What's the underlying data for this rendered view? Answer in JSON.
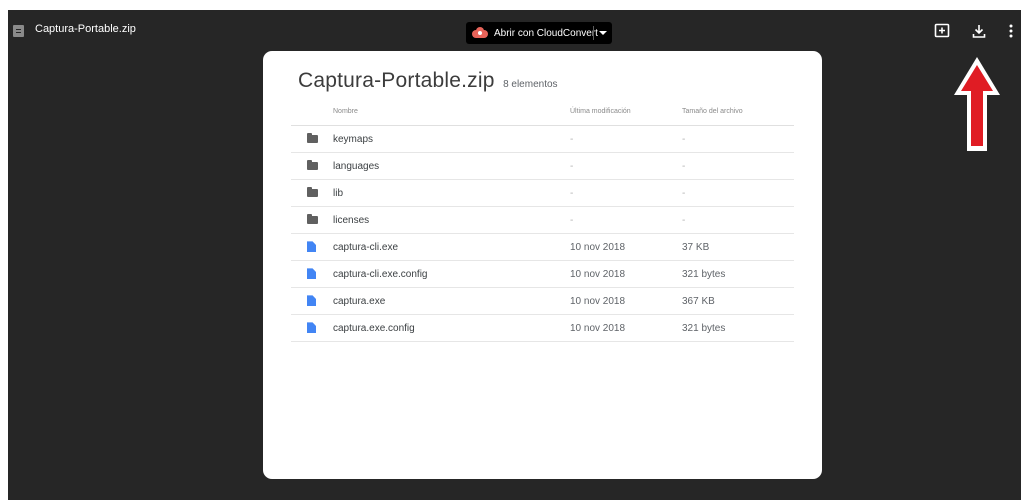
{
  "topbar": {
    "file_name": "Captura-Portable.zip",
    "open_with_label": "Abrir con CloudConvert",
    "icons": [
      "file-icon",
      "cloudconvert-icon",
      "chevron-down-icon",
      "add-comment-icon",
      "download-icon",
      "more-vert-icon"
    ]
  },
  "annotation": {
    "arrow_color": "#e01c24",
    "icon": "red-up-arrow-icon"
  },
  "card": {
    "title": "Captura-Portable.zip",
    "count": "8 elementos",
    "columns": {
      "name": "Nombre",
      "modified": "Última modificación",
      "size": "Tamaño del archivo"
    },
    "rows": [
      {
        "kind": "folder",
        "icon": "folder-icon",
        "name": "keymaps",
        "modified": "-",
        "size": "-"
      },
      {
        "kind": "folder",
        "icon": "folder-icon",
        "name": "languages",
        "modified": "-",
        "size": "-"
      },
      {
        "kind": "folder",
        "icon": "folder-icon",
        "name": "lib",
        "modified": "-",
        "size": "-"
      },
      {
        "kind": "folder",
        "icon": "folder-icon",
        "name": "licenses",
        "modified": "-",
        "size": "-"
      },
      {
        "kind": "file",
        "icon": "file-doc-icon",
        "name": "captura-cli.exe",
        "modified": "10 nov 2018",
        "size": "37 KB"
      },
      {
        "kind": "file",
        "icon": "file-doc-icon",
        "name": "captura-cli.exe.config",
        "modified": "10 nov 2018",
        "size": "321 bytes"
      },
      {
        "kind": "file",
        "icon": "file-doc-icon",
        "name": "captura.exe",
        "modified": "10 nov 2018",
        "size": "367 KB"
      },
      {
        "kind": "file",
        "icon": "file-doc-icon",
        "name": "captura.exe.config",
        "modified": "10 nov 2018",
        "size": "321 bytes"
      }
    ]
  },
  "colors": {
    "viewer_background": "#262626",
    "folder_icon": "#606060",
    "file_icon": "#4285f4",
    "cloudconvert": "#e8645a"
  }
}
